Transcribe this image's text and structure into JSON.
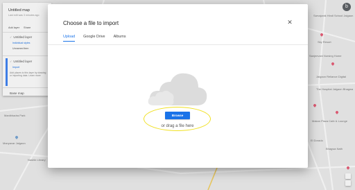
{
  "map_panel": {
    "title": "Untitled map",
    "subtitle": "Last edit was 3 minutes ago",
    "add_layer_label": "Add layer",
    "share_label": "Share",
    "layers": [
      {
        "name": "Untitled layer",
        "sub": "Individual styles",
        "extra": "Unnamed item"
      },
      {
        "name": "Untitled layer",
        "sub": "Import",
        "hint": "Add places to this layer by drawing or importing data. Learn more"
      }
    ],
    "base_map_label": "Base map"
  },
  "map_labels": [
    "Sarvajanik Hindi School Jalgaon",
    "Sky Resort",
    "Sanjeevani Nursing Home",
    "The Hospital Jalgaon Bhagwa",
    "Jalgaon Reliance Digital",
    "Makan Plaza Cafe & Lounge",
    "El Dorado",
    "Bhagwa Nath",
    "Manibhadra Park",
    "Nashik Library",
    "Manyavar Jalgaon"
  ],
  "avatar_letter": "b",
  "dialog": {
    "title": "Choose a file to import",
    "close_glyph": "✕",
    "tabs": [
      "Upload",
      "Google Drive",
      "Albums"
    ],
    "active_tab": "Upload",
    "browse_label": "Browse",
    "drag_text": "or drag a file here"
  },
  "colors": {
    "accent": "#1a73e8",
    "annotation_highlight": "#f0e020",
    "cloud": "#dcdcdc"
  },
  "icons": {
    "close": "close-icon",
    "cloud": "cloud-upload-icon"
  }
}
